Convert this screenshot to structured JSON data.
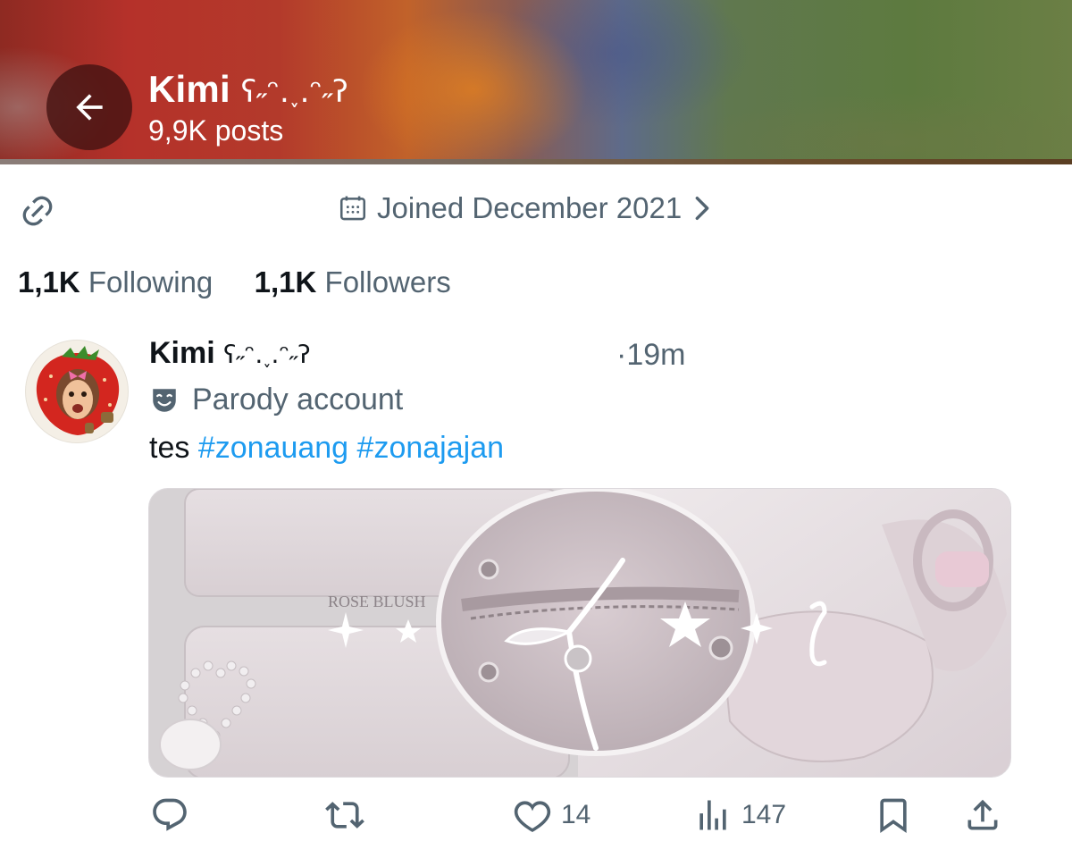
{
  "header": {
    "name": "Kimi",
    "name_emoticon": "ʕ˶ᵔ.˯.ᵔ˶ʔ",
    "post_count": "9,9K posts"
  },
  "profile": {
    "joined": "Joined December 2021",
    "following_count": "1,1K",
    "following_label": "Following",
    "followers_count": "1,1K",
    "followers_label": "Followers"
  },
  "post": {
    "author": "Kimi",
    "author_emoticon": "ʕ˶ᵔ.˯.ᵔ˶ʔ",
    "time": "·19m",
    "badge": "Parody account",
    "text_prefix": "tes",
    "hashtags": [
      "#zonauang",
      "#zonajajan"
    ],
    "media_caption": "ROSE BLUSH",
    "replies": "",
    "reposts": "",
    "likes": "14",
    "views": "147"
  },
  "icons": {
    "back": "arrow-left-icon",
    "link": "link-icon",
    "calendar": "calendar-icon",
    "chevron": "chevron-right-icon",
    "parody": "theater-mask-icon",
    "reply": "reply-icon",
    "repost": "repost-icon",
    "like": "heart-icon",
    "views": "analytics-icon",
    "bookmark": "bookmark-icon",
    "share": "share-icon"
  },
  "colors": {
    "accent": "#1d9bf0",
    "secondary_text": "#536471",
    "primary_text": "#0f1419"
  }
}
